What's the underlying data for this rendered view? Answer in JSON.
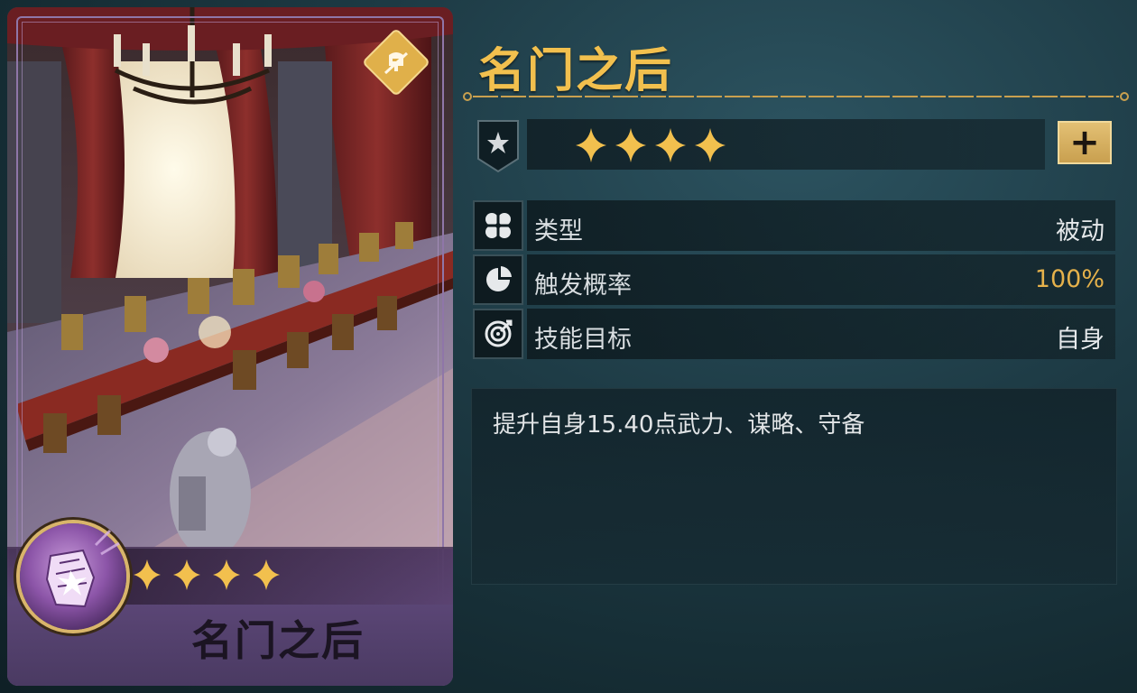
{
  "card": {
    "name": "名门之后",
    "stars": 4,
    "badge_icon": "helmet-sword-icon",
    "skill_icon": "armored-gauntlet-icon"
  },
  "panel": {
    "title": "名门之后",
    "stars": 4,
    "star_badge_icon": "star-shield-icon",
    "upgrade_button_label": "+",
    "attributes": [
      {
        "icon": "clover-icon",
        "label": "类型",
        "value": "被动"
      },
      {
        "icon": "pie-chart-icon",
        "label": "触发概率",
        "value": "100%"
      },
      {
        "icon": "target-icon",
        "label": "技能目标",
        "value": "自身"
      }
    ],
    "description": "提升自身15.40点武力、谋略、守备"
  },
  "colors": {
    "gold": "#f2c04e",
    "rate_value": "#e5b14b",
    "card_purple": "#5b4676",
    "panel_bg": "#1d3a44"
  }
}
